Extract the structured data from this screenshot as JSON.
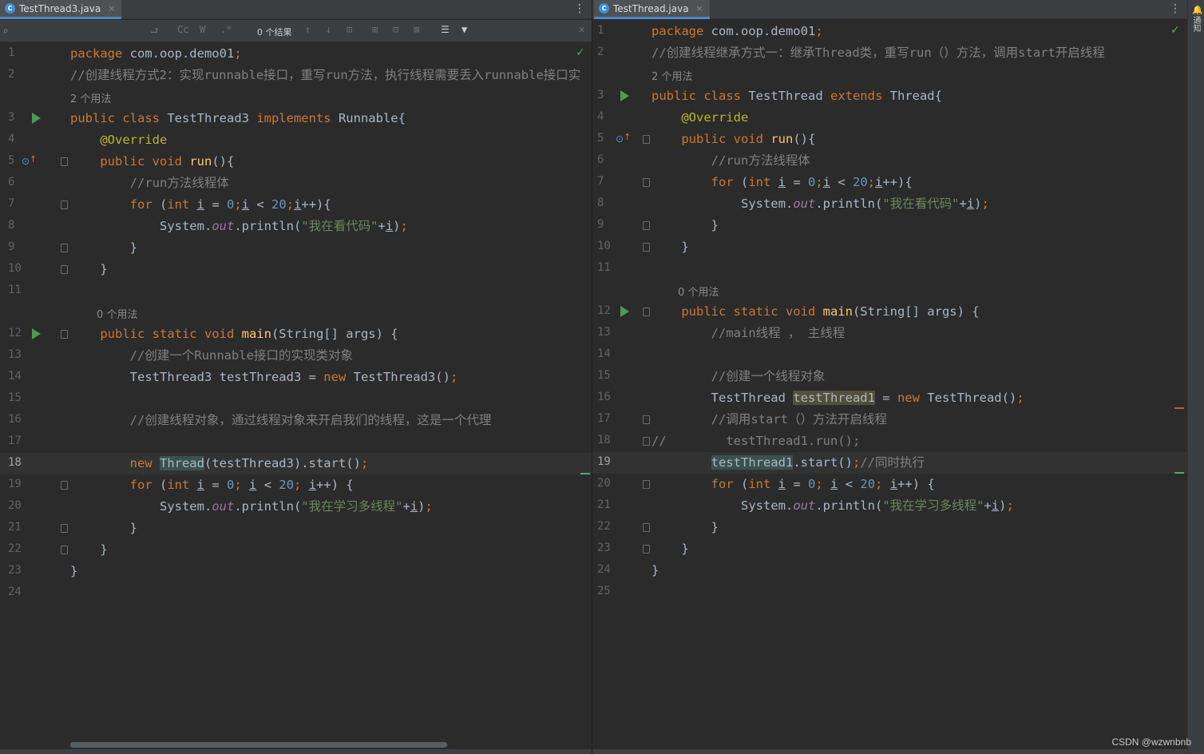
{
  "left_pane": {
    "tab": {
      "title": "TestThread3.java",
      "close": "×"
    },
    "menu": "⋮",
    "find_bar": {
      "tools": [
        "⮐",
        "Cc",
        "W",
        ".*"
      ],
      "result_count": "0 个结果",
      "nav": [
        "↑",
        "↓",
        "⊡",
        "⊞",
        "⊟",
        "⊠",
        "☰"
      ],
      "close": "×"
    },
    "check": "✓"
  },
  "right_pane": {
    "tab": {
      "title": "TestThread.java",
      "close": "×"
    },
    "menu": "⋮",
    "check": "✓"
  },
  "sidebar": {
    "label": "通知"
  },
  "watermark": "CSDN @wzwnbnb",
  "left_lines": [
    {
      "n": "1",
      "tokens": [
        [
          "kw",
          "package "
        ],
        [
          "plain",
          "com.oop.demo01"
        ],
        [
          "kw",
          ";"
        ]
      ]
    },
    {
      "n": "2",
      "tokens": [
        [
          "cm",
          "//创建线程方式2：实现runnable接口，重写run方法，执行线程需要丢入runnable接口实"
        ]
      ]
    },
    {
      "hint": "2 个用法"
    },
    {
      "n": "3",
      "run": true,
      "tokens": [
        [
          "kw",
          "public class "
        ],
        [
          "plain",
          "TestThread3 "
        ],
        [
          "kw",
          "implements "
        ],
        [
          "plain",
          "Runnable{"
        ]
      ]
    },
    {
      "n": "4",
      "tokens": [
        [
          "plain",
          "    "
        ],
        [
          "ann",
          "@Override"
        ]
      ]
    },
    {
      "n": "5",
      "override": true,
      "fold": true,
      "tokens": [
        [
          "plain",
          "    "
        ],
        [
          "kw",
          "public void "
        ],
        [
          "fn",
          "run"
        ],
        [
          "plain",
          "(){"
        ]
      ]
    },
    {
      "n": "6",
      "tokens": [
        [
          "plain",
          "        "
        ],
        [
          "cm",
          "//run方法线程体"
        ]
      ]
    },
    {
      "n": "7",
      "fold": true,
      "tokens": [
        [
          "plain",
          "        "
        ],
        [
          "kw",
          "for "
        ],
        [
          "plain",
          "("
        ],
        [
          "kw",
          "int "
        ],
        [
          "ul",
          "i"
        ],
        [
          "plain",
          " = "
        ],
        [
          "num",
          "0"
        ],
        [
          "kw",
          ";"
        ],
        [
          "ul",
          "i"
        ],
        [
          "plain",
          " < "
        ],
        [
          "num",
          "20"
        ],
        [
          "kw",
          ";"
        ],
        [
          "ul",
          "i"
        ],
        [
          "plain",
          "++){"
        ]
      ]
    },
    {
      "n": "8",
      "tokens": [
        [
          "plain",
          "            System."
        ],
        [
          "it",
          "out"
        ],
        [
          "plain",
          ".println("
        ],
        [
          "str",
          "\"我在看代码\""
        ],
        [
          "plain",
          "+"
        ],
        [
          "ul",
          "i"
        ],
        [
          "plain",
          ")"
        ],
        [
          "kw",
          ";"
        ]
      ]
    },
    {
      "n": "9",
      "fold": true,
      "tokens": [
        [
          "plain",
          "        }"
        ]
      ]
    },
    {
      "n": "10",
      "fold": true,
      "tokens": [
        [
          "plain",
          "    }"
        ]
      ]
    },
    {
      "n": "11",
      "tokens": []
    },
    {
      "hint": "    0 个用法"
    },
    {
      "n": "12",
      "run": true,
      "fold": true,
      "tokens": [
        [
          "plain",
          "    "
        ],
        [
          "kw",
          "public static void "
        ],
        [
          "fn",
          "main"
        ],
        [
          "plain",
          "(String[] args) {"
        ]
      ]
    },
    {
      "n": "13",
      "tokens": [
        [
          "plain",
          "        "
        ],
        [
          "cm",
          "//创建一个Runnable接口的实现类对象"
        ]
      ]
    },
    {
      "n": "14",
      "tokens": [
        [
          "plain",
          "        TestThread3 testThread3 = "
        ],
        [
          "kw",
          "new "
        ],
        [
          "plain",
          "TestThread3()"
        ],
        [
          "kw",
          ";"
        ]
      ]
    },
    {
      "n": "15",
      "tokens": []
    },
    {
      "n": "16",
      "tokens": [
        [
          "plain",
          "        "
        ],
        [
          "cm",
          "//创建线程对象，通过线程对象来开启我们的线程，这是一个代理"
        ]
      ]
    },
    {
      "n": "17",
      "tokens": []
    },
    {
      "n": "18",
      "current": true,
      "tokens": [
        [
          "plain",
          "        "
        ],
        [
          "kw",
          "new "
        ],
        [
          "hl",
          "Thread"
        ],
        [
          "plain",
          "(testThread3).start()"
        ],
        [
          "kw",
          ";"
        ]
      ]
    },
    {
      "n": "19",
      "fold": true,
      "tokens": [
        [
          "plain",
          "        "
        ],
        [
          "kw",
          "for "
        ],
        [
          "plain",
          "("
        ],
        [
          "kw",
          "int "
        ],
        [
          "ul",
          "i"
        ],
        [
          "plain",
          " = "
        ],
        [
          "num",
          "0"
        ],
        [
          "kw",
          "; "
        ],
        [
          "ul",
          "i"
        ],
        [
          "plain",
          " < "
        ],
        [
          "num",
          "20"
        ],
        [
          "kw",
          "; "
        ],
        [
          "ul",
          "i"
        ],
        [
          "plain",
          "++) {"
        ]
      ]
    },
    {
      "n": "20",
      "tokens": [
        [
          "plain",
          "            System."
        ],
        [
          "it",
          "out"
        ],
        [
          "plain",
          ".println("
        ],
        [
          "str",
          "\"我在学习多线程\""
        ],
        [
          "plain",
          "+"
        ],
        [
          "ul",
          "i"
        ],
        [
          "plain",
          ")"
        ],
        [
          "kw",
          ";"
        ]
      ]
    },
    {
      "n": "21",
      "fold": true,
      "tokens": [
        [
          "plain",
          "        }"
        ]
      ]
    },
    {
      "n": "22",
      "fold": true,
      "tokens": [
        [
          "plain",
          "    }"
        ]
      ]
    },
    {
      "n": "23",
      "tokens": [
        [
          "plain",
          "}"
        ]
      ]
    },
    {
      "n": "24",
      "tokens": []
    }
  ],
  "right_lines": [
    {
      "n": "1",
      "tokens": [
        [
          "kw",
          "package "
        ],
        [
          "plain",
          "com.oop.demo01"
        ],
        [
          "kw",
          ";"
        ]
      ]
    },
    {
      "n": "2",
      "tokens": [
        [
          "cm",
          "//创建线程继承方式一：继承Thread类，重写run（）方法，调用start开启线程"
        ]
      ]
    },
    {
      "hint": "2 个用法"
    },
    {
      "n": "3",
      "run": true,
      "tokens": [
        [
          "kw",
          "public class "
        ],
        [
          "plain",
          "TestThread "
        ],
        [
          "kw",
          "extends "
        ],
        [
          "plain",
          "Thread{"
        ]
      ]
    },
    {
      "n": "4",
      "tokens": [
        [
          "plain",
          "    "
        ],
        [
          "ann",
          "@Override"
        ]
      ]
    },
    {
      "n": "5",
      "override": true,
      "fold": true,
      "tokens": [
        [
          "plain",
          "    "
        ],
        [
          "kw",
          "public void "
        ],
        [
          "fn",
          "run"
        ],
        [
          "plain",
          "(){"
        ]
      ]
    },
    {
      "n": "6",
      "tokens": [
        [
          "plain",
          "        "
        ],
        [
          "cm",
          "//run方法线程体"
        ]
      ]
    },
    {
      "n": "7",
      "fold": true,
      "tokens": [
        [
          "plain",
          "        "
        ],
        [
          "kw",
          "for "
        ],
        [
          "plain",
          "("
        ],
        [
          "kw",
          "int "
        ],
        [
          "ul",
          "i"
        ],
        [
          "plain",
          " = "
        ],
        [
          "num",
          "0"
        ],
        [
          "kw",
          ";"
        ],
        [
          "ul",
          "i"
        ],
        [
          "plain",
          " < "
        ],
        [
          "num",
          "20"
        ],
        [
          "kw",
          ";"
        ],
        [
          "ul",
          "i"
        ],
        [
          "plain",
          "++){"
        ]
      ]
    },
    {
      "n": "8",
      "tokens": [
        [
          "plain",
          "            System."
        ],
        [
          "it",
          "out"
        ],
        [
          "plain",
          ".println("
        ],
        [
          "str",
          "\"我在看代码\""
        ],
        [
          "plain",
          "+"
        ],
        [
          "ul",
          "i"
        ],
        [
          "plain",
          ")"
        ],
        [
          "kw",
          ";"
        ]
      ]
    },
    {
      "n": "9",
      "fold": true,
      "tokens": [
        [
          "plain",
          "        }"
        ]
      ]
    },
    {
      "n": "10",
      "fold": true,
      "tokens": [
        [
          "plain",
          "    }"
        ]
      ]
    },
    {
      "n": "11",
      "tokens": []
    },
    {
      "hint": "    0 个用法"
    },
    {
      "n": "12",
      "run": true,
      "fold": true,
      "tokens": [
        [
          "plain",
          "    "
        ],
        [
          "kw",
          "public static void "
        ],
        [
          "fn",
          "main"
        ],
        [
          "plain",
          "(String[] args) {"
        ]
      ]
    },
    {
      "n": "13",
      "tokens": [
        [
          "plain",
          "        "
        ],
        [
          "cm",
          "//main线程 ， 主线程"
        ]
      ]
    },
    {
      "n": "14",
      "tokens": []
    },
    {
      "n": "15",
      "tokens": [
        [
          "plain",
          "        "
        ],
        [
          "cm",
          "//创建一个线程对象"
        ]
      ]
    },
    {
      "n": "16",
      "tokens": [
        [
          "plain",
          "        TestThread "
        ],
        [
          "hlwarn",
          "testThread1"
        ],
        [
          "plain",
          " = "
        ],
        [
          "kw",
          "new "
        ],
        [
          "plain",
          "TestThread()"
        ],
        [
          "kw",
          ";"
        ]
      ]
    },
    {
      "n": "17",
      "fold": true,
      "tokens": [
        [
          "plain",
          "        "
        ],
        [
          "cm",
          "//调用start（）方法开启线程"
        ]
      ]
    },
    {
      "n": "18",
      "fold": true,
      "tokens": [
        [
          "cm",
          "//        testThread1.run();"
        ]
      ]
    },
    {
      "n": "19",
      "current": true,
      "tokens": [
        [
          "plain",
          "        "
        ],
        [
          "hl",
          "testThread1"
        ],
        [
          "plain",
          ".start()"
        ],
        [
          "kw",
          ";"
        ],
        [
          "cm",
          "//同时执行"
        ]
      ]
    },
    {
      "n": "20",
      "fold": true,
      "tokens": [
        [
          "plain",
          "        "
        ],
        [
          "kw",
          "for "
        ],
        [
          "plain",
          "("
        ],
        [
          "kw",
          "int "
        ],
        [
          "ul",
          "i"
        ],
        [
          "plain",
          " = "
        ],
        [
          "num",
          "0"
        ],
        [
          "kw",
          "; "
        ],
        [
          "ul",
          "i"
        ],
        [
          "plain",
          " < "
        ],
        [
          "num",
          "20"
        ],
        [
          "kw",
          "; "
        ],
        [
          "ul",
          "i"
        ],
        [
          "plain",
          "++) {"
        ]
      ]
    },
    {
      "n": "21",
      "tokens": [
        [
          "plain",
          "            System."
        ],
        [
          "it",
          "out"
        ],
        [
          "plain",
          ".println("
        ],
        [
          "str",
          "\"我在学习多线程\""
        ],
        [
          "plain",
          "+"
        ],
        [
          "ul",
          "i"
        ],
        [
          "plain",
          ")"
        ],
        [
          "kw",
          ";"
        ]
      ]
    },
    {
      "n": "22",
      "fold": true,
      "tokens": [
        [
          "plain",
          "        }"
        ]
      ]
    },
    {
      "n": "23",
      "fold": true,
      "tokens": [
        [
          "plain",
          "    }"
        ]
      ]
    },
    {
      "n": "24",
      "tokens": [
        [
          "plain",
          "}"
        ]
      ]
    },
    {
      "n": "25",
      "tokens": []
    }
  ]
}
